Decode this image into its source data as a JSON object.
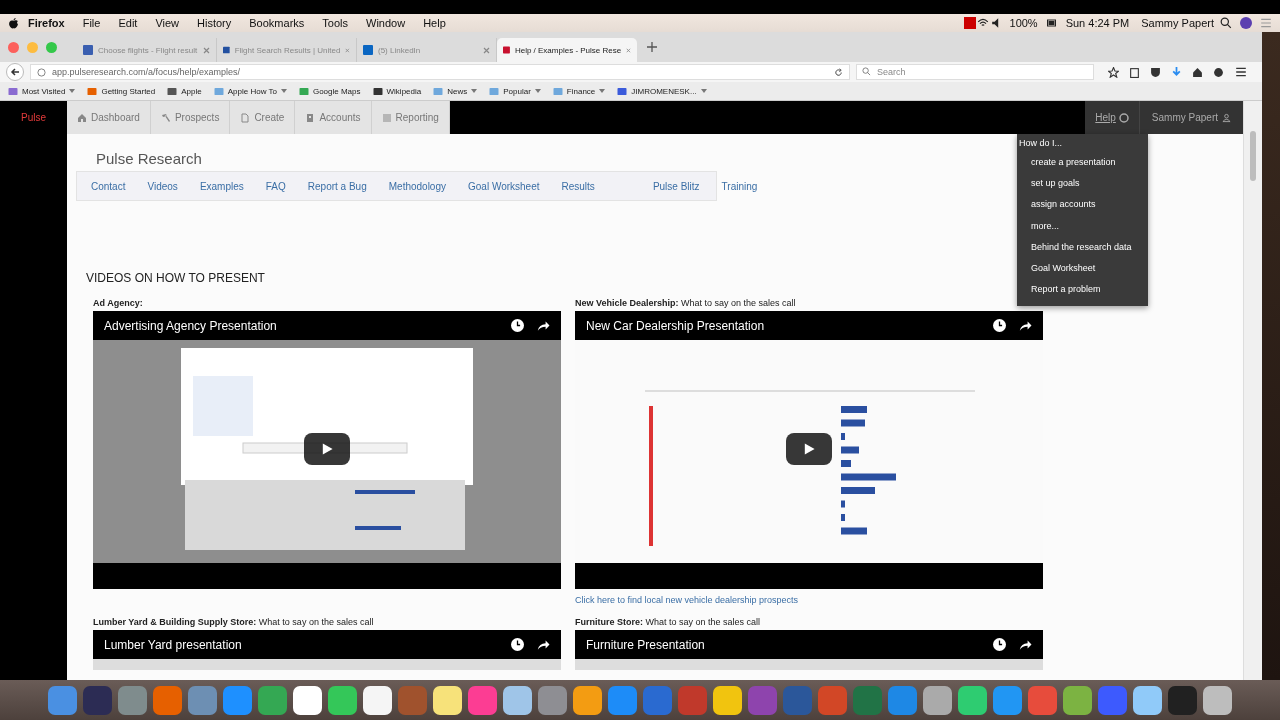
{
  "menubar": {
    "app": "Firefox",
    "menus": [
      "File",
      "Edit",
      "View",
      "History",
      "Bookmarks",
      "Tools",
      "Window",
      "Help"
    ],
    "battery": "100%",
    "clock": "Sun 4:24 PM",
    "user": "Sammy Papert"
  },
  "browser": {
    "tabs": [
      {
        "title": "Choose flights - Flight result",
        "selected": false
      },
      {
        "title": "Flight Search Results | United",
        "selected": false
      },
      {
        "title": "(5) LinkedIn",
        "selected": false
      },
      {
        "title": "Help / Examples - Pulse Rese",
        "selected": true
      }
    ],
    "url": "app.pulseresearch.com/a/focus/help/examples/",
    "search_placeholder": "Search",
    "bookmarks": [
      {
        "label": "Most Visited",
        "dropdown": true
      },
      {
        "label": "Getting Started",
        "dropdown": false
      },
      {
        "label": "Apple",
        "dropdown": false
      },
      {
        "label": "Apple How To",
        "dropdown": true
      },
      {
        "label": "Google Maps",
        "dropdown": false
      },
      {
        "label": "Wikipedia",
        "dropdown": false
      },
      {
        "label": "News",
        "dropdown": true
      },
      {
        "label": "Popular",
        "dropdown": true
      },
      {
        "label": "Finance",
        "dropdown": true
      },
      {
        "label": "JIMROMENESK...",
        "dropdown": true
      }
    ]
  },
  "app": {
    "brand": "Pulse",
    "nav": [
      "Dashboard",
      "Prospects",
      "Create",
      "Accounts",
      "Reporting"
    ],
    "help": "Help",
    "user": "Sammy Papert",
    "help_menu": {
      "open": true,
      "heading": "How do I...",
      "items": [
        "create a presentation",
        "set up goals",
        "assign accounts",
        "more...",
        "Behind the research data",
        "Goal Worksheet",
        "Report a problem"
      ]
    }
  },
  "page": {
    "title": "Pulse Research",
    "subnav": [
      "Contact",
      "Videos",
      "Examples",
      "FAQ",
      "Report a Bug",
      "Methodology",
      "Goal Worksheet",
      "Results",
      "Pulse Blitz",
      "Training"
    ],
    "section": "VIDEOS ON HOW TO PRESENT",
    "videos": [
      {
        "caption": "**Ad Agency:**",
        "title": "Advertising Agency Presentation",
        "kind": "dialog"
      },
      {
        "caption": "**New Vehicle Dealership:** What to say on the sales call",
        "title": "New Car Dealership Presentation",
        "kind": "table",
        "link": "Click here to find local new vehicle dealership prospects"
      },
      {
        "caption": "**Lumber Yard & Building Supply Store:** What to say on the sales call",
        "title": "Lumber Yard presentation",
        "kind": "cut"
      },
      {
        "caption": "**Furniture Store:** What to say on the sales call",
        "title": "Furniture Presentation",
        "kind": "cut"
      }
    ]
  }
}
